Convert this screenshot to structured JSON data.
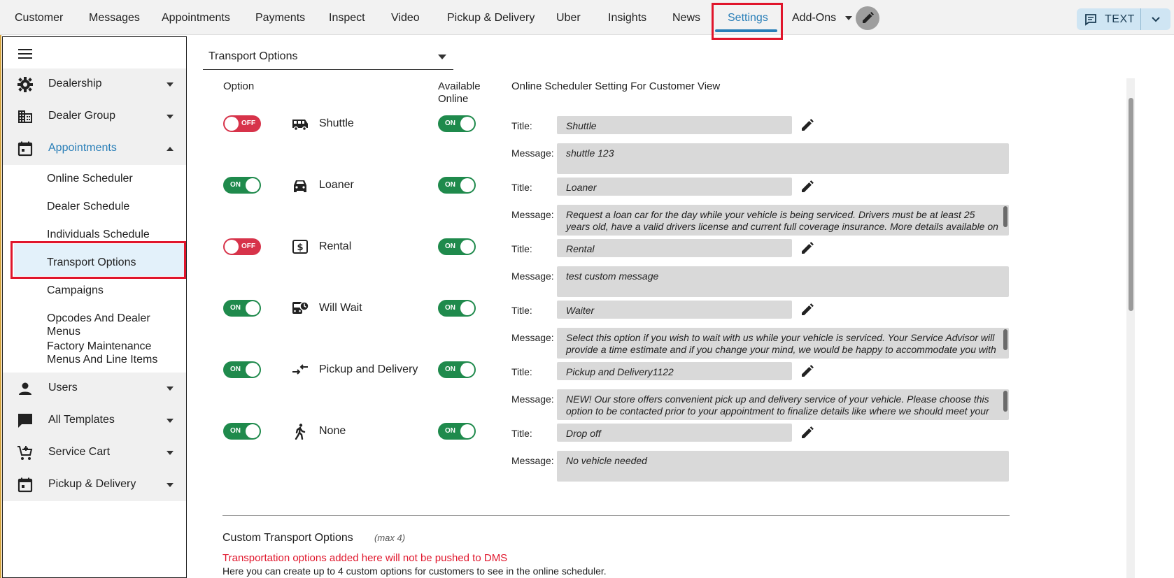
{
  "topnav": {
    "tabs": [
      "Customer",
      "Messages",
      "Appointments",
      "Payments",
      "Inspect",
      "Video",
      "Pickup & Delivery",
      "Uber",
      "Insights",
      "News",
      "Settings",
      "Add-Ons"
    ],
    "active_tab": "Settings",
    "text_button": "TEXT"
  },
  "sidebar": {
    "groups": [
      {
        "label": "Dealership",
        "icon": "gear-icon"
      },
      {
        "label": "Dealer Group",
        "icon": "building-icon"
      },
      {
        "label": "Appointments",
        "icon": "calendar-icon",
        "expanded": true
      },
      {
        "label": "Users",
        "icon": "person-icon"
      },
      {
        "label": "All Templates",
        "icon": "chat-icon"
      },
      {
        "label": "Service Cart",
        "icon": "cart-icon"
      },
      {
        "label": "Pickup & Delivery",
        "icon": "calendar-icon"
      }
    ],
    "appointments_items": [
      "Online Scheduler",
      "Dealer Schedule",
      "Individuals Schedule",
      "Transport Options",
      "Campaigns",
      "Opcodes And Dealer Menus",
      "Factory Maintenance Menus And Line Items"
    ],
    "active_item": "Transport Options"
  },
  "main": {
    "select_value": "Transport Options",
    "headers": {
      "option": "Option",
      "available_online": "Available Online",
      "setting": "Online Scheduler Setting For Customer View"
    },
    "title_label": "Title:",
    "message_label": "Message:",
    "options": [
      {
        "name": "Shuttle",
        "icon": "shuttle-icon",
        "enabled": "OFF",
        "online": "ON",
        "title": "Shuttle",
        "message": "shuttle 123",
        "scroll": false
      },
      {
        "name": "Loaner",
        "icon": "car-icon",
        "enabled": "ON",
        "online": "ON",
        "title": "Loaner",
        "message": "Request a loan car for the day while your vehicle is being serviced. Drivers must be at least 25 years old, have a valid drivers license and current full coverage insurance. More details available on our",
        "scroll": true
      },
      {
        "name": "Rental",
        "icon": "rental-dollar-icon",
        "enabled": "OFF",
        "online": "ON",
        "title": "Rental",
        "message": "test custom message",
        "scroll": false
      },
      {
        "name": "Will Wait",
        "icon": "bus-clock-icon",
        "enabled": "ON",
        "online": "ON",
        "title": "Waiter",
        "message": "Select this option if you wish to wait with us while your vehicle is serviced. Your Service Advisor will provide a time estimate and if you change your mind, we would be happy to accommodate you with",
        "scroll": true
      },
      {
        "name": "Pickup and Delivery",
        "icon": "swap-arrows-icon",
        "enabled": "ON",
        "online": "ON",
        "title": "Pickup and Delivery1122",
        "message": "NEW! Our store offers convenient pick up and delivery service of your vehicle. Please choose this option to be contacted prior to your appointment to finalize details like where we should meet your",
        "scroll": true
      },
      {
        "name": "None",
        "icon": "walking-icon",
        "enabled": "ON",
        "online": "ON",
        "title": "Drop off",
        "message": "No vehicle needed",
        "scroll": false
      }
    ],
    "custom": {
      "title": "Custom Transport Options",
      "max": "(max 4)",
      "warning": "Transportation options added here will not be pushed to DMS",
      "helper": "Here you can create up to 4 custom options for customers to see in the online scheduler."
    }
  }
}
